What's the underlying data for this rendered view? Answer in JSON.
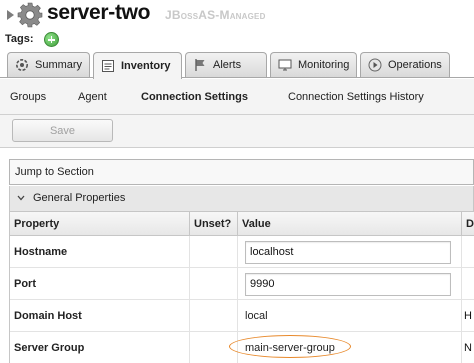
{
  "header": {
    "title": "server-two",
    "resource_type": "JBossAS-Managed",
    "tags_label": "Tags:"
  },
  "tabs": [
    {
      "label": "Summary",
      "icon": "summary-icon",
      "active": false
    },
    {
      "label": "Inventory",
      "icon": "inventory-icon",
      "active": true
    },
    {
      "label": "Alerts",
      "icon": "flag-icon",
      "active": false
    },
    {
      "label": "Monitoring",
      "icon": "monitor-icon",
      "active": false
    },
    {
      "label": "Operations",
      "icon": "play-icon",
      "active": false
    }
  ],
  "subtabs": [
    {
      "label": "Groups",
      "active": false
    },
    {
      "label": "Agent",
      "active": false
    },
    {
      "label": "Connection Settings",
      "active": true
    },
    {
      "label": "Connection Settings History",
      "active": false
    }
  ],
  "toolbar": {
    "save_label": "Save"
  },
  "jump": {
    "label": "Jump to Section"
  },
  "section": {
    "title": "General Properties"
  },
  "table": {
    "headers": {
      "property": "Property",
      "unset": "Unset?",
      "value": "Value",
      "description": "D"
    },
    "rows": [
      {
        "property": "Hostname",
        "value": "localhost",
        "editable": true,
        "description": ""
      },
      {
        "property": "Port",
        "value": "9990",
        "editable": true,
        "description": ""
      },
      {
        "property": "Domain Host",
        "value": "local",
        "editable": false,
        "description": "H"
      },
      {
        "property": "Server Group",
        "value": "main-server-group",
        "editable": false,
        "description": "N"
      }
    ]
  },
  "colors": {
    "highlight": "#e8892b",
    "tag_add": "#3f9f3a"
  }
}
